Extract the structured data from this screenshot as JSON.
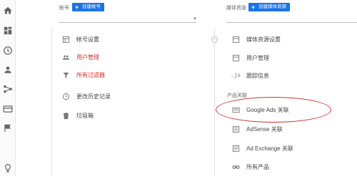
{
  "rail": {
    "icons": [
      "home-icon",
      "dashboard-icon",
      "clock-icon",
      "person-icon",
      "share-icon",
      "card-icon",
      "flag-icon",
      "lightbulb-icon"
    ]
  },
  "account_column": {
    "label": "帐号",
    "create_button": "创建帐号",
    "items": [
      {
        "icon": "square-icon",
        "label": "帐号设置",
        "highlight": false
      },
      {
        "icon": "people-icon",
        "label": "用户管理",
        "highlight": true
      },
      {
        "icon": "filter-icon",
        "label": "所有过滤器",
        "highlight": true
      },
      {
        "icon": "history-icon",
        "label": "更改历史记录",
        "highlight": false
      },
      {
        "icon": "trash-icon",
        "label": "垃圾箱",
        "highlight": false
      }
    ]
  },
  "property_column": {
    "label": "媒体资源",
    "create_button": "创建媒体资源",
    "items": [
      {
        "icon": "square-icon",
        "label": "媒体资源设置"
      },
      {
        "icon": "people-icon",
        "label": "用户管理"
      },
      {
        "icon": "js-icon",
        "label": "跟踪信息"
      }
    ],
    "section_header": "产品关联",
    "linked_items": [
      {
        "icon": "ads-icon",
        "label": "Google Ads 关联"
      },
      {
        "icon": "adsense-icon",
        "label": "AdSense 关联"
      },
      {
        "icon": "adexchange-icon",
        "label": "Ad Exchange 关联"
      },
      {
        "icon": "link-icon",
        "label": "所有产品"
      }
    ]
  },
  "colors": {
    "accent": "#1a73e8",
    "highlight_text": "#d93025",
    "annotation": "#d32f2f"
  }
}
